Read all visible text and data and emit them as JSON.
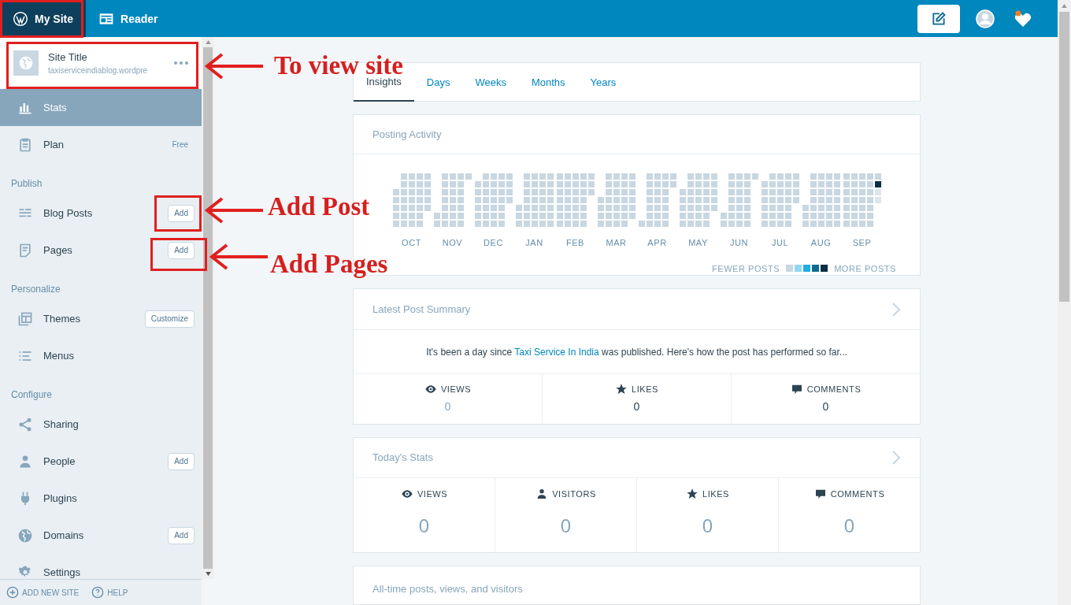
{
  "topbar": {
    "items": [
      {
        "label": "My Site",
        "selected": true
      },
      {
        "label": "Reader",
        "selected": false
      }
    ],
    "notifications": {
      "unread": true
    }
  },
  "sidebar": {
    "site": {
      "title": "Site Title",
      "url": "taxiserviceindiablog.wordpre"
    },
    "sections": [
      {
        "items": [
          {
            "label": "Stats",
            "selected": true
          },
          {
            "label": "Plan",
            "selected": false,
            "badge": "Free"
          }
        ]
      },
      {
        "label": "Publish",
        "items": [
          {
            "label": "Blog Posts",
            "selected": false,
            "button": "Add"
          },
          {
            "label": "Pages",
            "selected": false,
            "button": "Add"
          }
        ]
      },
      {
        "label": "Personalize",
        "items": [
          {
            "label": "Themes",
            "selected": false,
            "button": "Customize"
          },
          {
            "label": "Menus",
            "selected": false
          }
        ]
      },
      {
        "label": "Configure",
        "items": [
          {
            "label": "Sharing",
            "selected": false
          },
          {
            "label": "People",
            "selected": false,
            "button": "Add"
          },
          {
            "label": "Plugins",
            "selected": false
          },
          {
            "label": "Domains",
            "selected": false,
            "button": "Add"
          },
          {
            "label": "Settings",
            "selected": false
          }
        ]
      }
    ],
    "footer": [
      "ADD NEW SITE",
      "HELP"
    ]
  },
  "tabs": [
    {
      "label": "Insights",
      "selected": true
    },
    {
      "label": "Days",
      "selected": false
    },
    {
      "label": "Weeks",
      "selected": false
    },
    {
      "label": "Months",
      "selected": false
    },
    {
      "label": "Years",
      "selected": false
    }
  ],
  "posting_activity": {
    "title": "Posting Activity",
    "months": [
      {
        "label": "OCT",
        "has_posts": false
      },
      {
        "label": "NOV",
        "has_posts": false
      },
      {
        "label": "DEC",
        "has_posts": false
      },
      {
        "label": "JAN",
        "has_posts": false
      },
      {
        "label": "FEB",
        "has_posts": false
      },
      {
        "label": "MAR",
        "has_posts": false
      },
      {
        "label": "APR",
        "has_posts": false
      },
      {
        "label": "MAY",
        "has_posts": false
      },
      {
        "label": "JUN",
        "has_posts": false
      },
      {
        "label": "JUL",
        "has_posts": false
      },
      {
        "label": "AUG",
        "has_posts": false
      },
      {
        "label": "SEP",
        "has_posts": true
      }
    ],
    "legend": {
      "fewer": "FEWER POSTS",
      "more": "MORE POSTS",
      "colors": [
        {
          "color": "#c8d7e1"
        },
        {
          "color": "#92d6f2"
        },
        {
          "color": "#1eaee3"
        },
        {
          "color": "#0e6b92"
        },
        {
          "color": "#0a2f42"
        }
      ]
    }
  },
  "latest_post": {
    "title": "Latest Post Summary",
    "sentence": {
      "before": "It's been a day since",
      "link": "Taxi Service In India",
      "after": "was published. Here's how the post has performed so far..."
    },
    "stats": [
      {
        "kind": "views",
        "label": "VIEWS",
        "value": "0",
        "linked": true
      },
      {
        "kind": "likes",
        "label": "LIKES",
        "value": "0",
        "linked": false
      },
      {
        "kind": "comments",
        "label": "COMMENTS",
        "value": "0",
        "linked": false
      }
    ]
  },
  "todays_stats": {
    "title": "Today's Stats",
    "stats": [
      {
        "kind": "views",
        "label": "VIEWS",
        "value": "0"
      },
      {
        "kind": "visitors",
        "label": "VISITORS",
        "value": "0"
      },
      {
        "kind": "likes",
        "label": "LIKES",
        "value": "0"
      },
      {
        "kind": "comments",
        "label": "COMMENTS",
        "value": "0"
      }
    ]
  },
  "all_time": {
    "title": "All-time posts, views, and visitors"
  },
  "annotations": [
    {
      "text": "To view site"
    },
    {
      "text": "Add Post"
    },
    {
      "text": "Add Pages"
    }
  ]
}
